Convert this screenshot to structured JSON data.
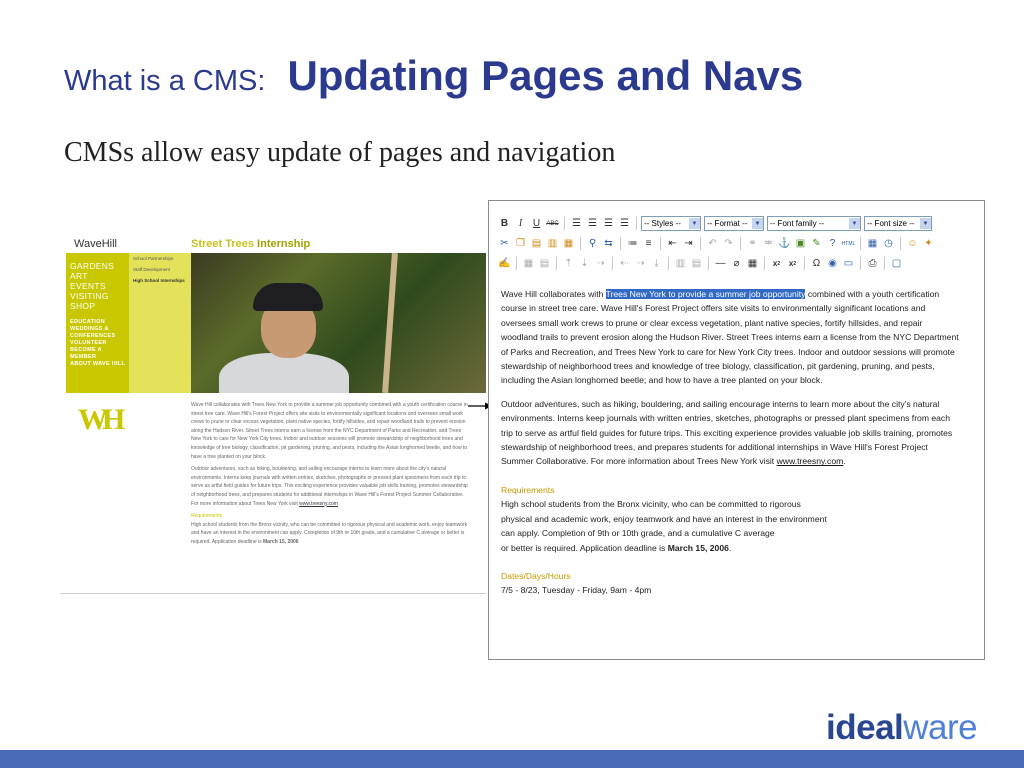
{
  "title": {
    "prefix": "What is a CMS:",
    "main": "Updating Pages and Navs"
  },
  "subtitle": "CMSs allow easy update of pages and navigation",
  "website": {
    "logo": "WaveHill",
    "program_title": {
      "part1": "Street Trees ",
      "part2": "Internship"
    },
    "nav_items": [
      "GARDENS",
      "ART",
      "EVENTS",
      "VISITING",
      "SHOP"
    ],
    "nav_secondary": [
      "EDUCATION",
      "WEDDINGS & CONFERENCES",
      "VOLUNTEER",
      "BECOME A MEMBER",
      "ABOUT WAVE HILL"
    ],
    "subnav_items": [
      "School Partnerships",
      "Staff Development",
      "High School Internships"
    ],
    "body_p1": "Wave Hill collaborates with Trees New York to provide a summer job opportunity combined with a youth certification course in street tree care. Wave Hill's Forest Project offers site visits to environmentally significant locations and oversees small work crews to prune or clear excess vegetation, plant native species, fortify hillsides, and repair woodland trails to prevent erosion along the Hudson River. Street Trees interns earn a license from the NYC Department of Parks and Recreation, and Trees New York to care for New York City trees. Indoor and outdoor sessions will promote stewardship of neighborhood trees and knowledge of tree biology, classification, pit gardening, pruning, and pests, including the Asian longhorned beetle, and how to have a tree planted on your block.",
    "body_p2": "Outdoor adventures, such as hiking, bouldering, and sailing encourage interns to learn more about the city's natural environments. Interns keep journals with written entries, sketches, photographs or pressed plant specimens from each trip to serve as artful field guides for future trips. This exciting experience provides valuable job skills training, promotes stewardship of neighborhood trees, and prepares students for additional internships in Wave Hill's Forest Project Summer Collaborative. For more information about Trees New York visit",
    "body_link": "www.treesny.com",
    "requirements_heading": "Requirements",
    "requirements_text": "High school students from the Bronx vicinity, who can be committed to rigorous physical and academic work, enjoy teamwork and have an interest in the environment can apply. Completion of 9th or 10th grade, and a cumulative C average or better is required. Application deadline is",
    "deadline": "March 15, 2006"
  },
  "editor": {
    "toolbar": {
      "styles": "-- Styles --",
      "format": "-- Format --",
      "font_family": "-- Font family --",
      "font_size": "-- Font size --"
    },
    "p1_before": "Wave Hill collaborates with ",
    "p1_highlight": "Trees New York to provide a summer job opportunity",
    "p1_after": " combined with a youth certification course in street tree care. Wave Hill's Forest Project offers site visits to environmentally significant locations and oversees small work crews to prune or clear excess vegetation, plant native species, fortify hillsides, and repair woodland trails to prevent erosion along the Hudson River. Street Trees interns earn a license from the NYC Department of Parks and Recreation, and Trees New York to care for New York City trees. Indoor and outdoor sessions will promote stewardship of neighborhood trees and knowledge of tree biology, classification, pit gardening, pruning, and pests, including the Asian longhorned beetle; and how to have a tree planted on your block.",
    "p2": "Outdoor adventures, such as hiking, bouldering, and sailing encourage interns to learn more about the city's natural environments. Interns keep journals with written entries, sketches, photographs or pressed plant specimens from each trip to serve as artful field guides for future trips. This exciting experience provides valuable job skills training, promotes stewardship of neighborhood trees, and prepares students for additional internships in Wave Hill's Forest Project Summer Collaborative. For more information about Trees New York visit ",
    "p2_link": "www.treesny.com",
    "requirements_heading": "Requirements",
    "requirements_lines": [
      "High school students from the Bronx vicinity, who can be committed to rigorous",
      "physical and academic work, enjoy teamwork and have an interest in the environment",
      "can apply. Completion of 9th or 10th grade, and a cumulative C average"
    ],
    "requirements_last_before": "or better is required. Application deadline is ",
    "deadline": "March 15, 2006",
    "dates_heading": "Dates/Days/Hours",
    "dates_text": "7/5 - 8/23, Tuesday - Friday, 9am - 4pm"
  },
  "brand": {
    "part1": "ideal",
    "part2": "ware"
  },
  "colors": {
    "title": "#2b3a8f",
    "website_accent": "#c9c800",
    "highlight": "#316ac5",
    "footer_bar": "#4a6bb8"
  }
}
